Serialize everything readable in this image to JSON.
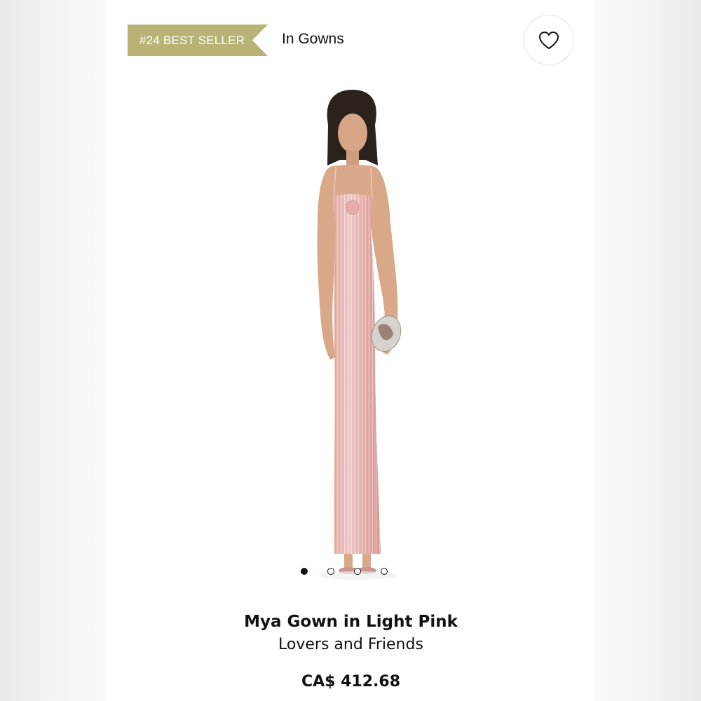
{
  "badge": {
    "label": "#24 BEST SELLER",
    "color": "#b8b374"
  },
  "category": {
    "label": "In Gowns"
  },
  "favorite": {
    "icon": "heart-icon"
  },
  "product": {
    "image": "model-in-light-pink-pleated-gown",
    "name": "Mya Gown in Light Pink",
    "brand": "Lovers and Friends",
    "price": "CA$ 412.68",
    "dress_color": "#e7b5b2"
  },
  "carousel": {
    "total": 4,
    "active_index": 0
  }
}
